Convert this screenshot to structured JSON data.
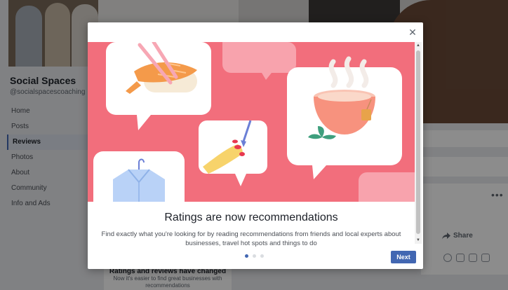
{
  "page": {
    "name": "Social Spaces",
    "handle": "@socialspacescoaching"
  },
  "nav": {
    "items": [
      {
        "label": "Home"
      },
      {
        "label": "Posts"
      },
      {
        "label": "Reviews",
        "active": true
      },
      {
        "label": "Photos"
      },
      {
        "label": "About"
      },
      {
        "label": "Community"
      },
      {
        "label": "Info and Ads"
      }
    ]
  },
  "post": {
    "share_label": "Share",
    "more_icon": "more-dots-icon"
  },
  "background_notice": {
    "title": "Ratings and reviews have changed",
    "text": "Now it's easier to find great businesses with recommendations"
  },
  "modal": {
    "close_icon": "close-icon",
    "title": "Ratings are now recommendations",
    "description": "Find exactly what you're looking for by reading recommendations from friends and local experts about businesses, travel hot spots and things to do",
    "next_label": "Next",
    "pagination": {
      "current": 1,
      "total": 3
    }
  },
  "colors": {
    "illustration_bg": "#f26e7c",
    "accent": "#4267b2"
  }
}
